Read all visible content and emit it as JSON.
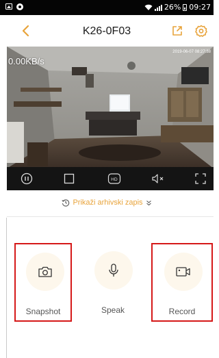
{
  "status_bar": {
    "battery_percent": "26%",
    "time": "09:27"
  },
  "header": {
    "title": "K26-0F03"
  },
  "video": {
    "bitrate": "0.00KB/s",
    "timestamp": "2019-06-07 08:27:38"
  },
  "archive": {
    "label": "Prikaži arhivski zapis"
  },
  "actions": {
    "snapshot": "Snapshot",
    "speak": "Speak",
    "record": "Record"
  },
  "colors": {
    "accent": "#e8a33a",
    "highlight_border": "#d51818"
  },
  "icons": {
    "back": "back-arrow-icon",
    "share": "share-icon",
    "settings": "settings-icon",
    "pause": "pause-icon",
    "stop": "stop-icon",
    "hd": "hd-icon",
    "mute": "mute-icon",
    "fullscreen": "fullscreen-icon",
    "history": "history-icon",
    "expand": "double-chevron-down-icon",
    "camera": "camera-icon",
    "mic": "microphone-icon",
    "video": "video-camera-icon"
  }
}
